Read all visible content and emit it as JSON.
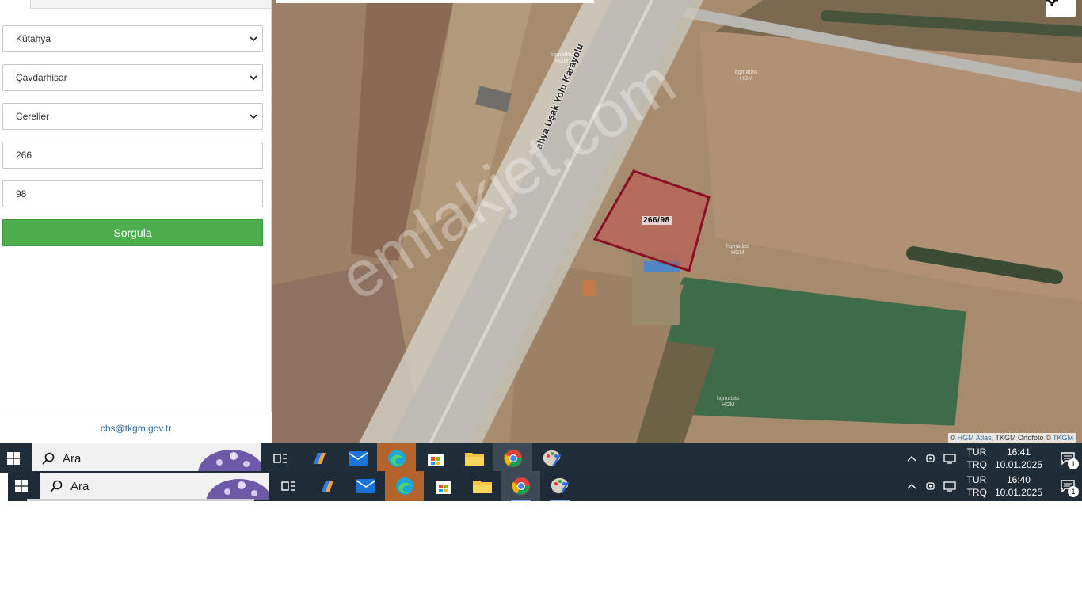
{
  "form": {
    "province": "Kütahya",
    "district": "Çavdarhisar",
    "neighborhood": "Cereller",
    "block_no": "266",
    "parcel_no": "98",
    "submit_label": "Sorgula"
  },
  "footer": {
    "email": "cbs@tkgm.gov.tr"
  },
  "map": {
    "parcel_label": "266/98",
    "road_label": "ahya Uşak Yolu Karayolu",
    "watermark": "emlakjet.com",
    "hgm_marks": [
      "hgmatlas\nHGM",
      "hgmatlas\nHGM",
      "hgmatlas\nHGM",
      "hgmatlas\nHGM"
    ],
    "attribution": {
      "prefix": "© ",
      "hgm": "HGM Atlas",
      "middle": ", TKGM Ortofoto © ",
      "tkgm": "TKGM"
    },
    "parcel_color": "#8b0f24",
    "settings_icon": "gear-icon"
  },
  "taskbar1": {
    "search_label": "Ara",
    "lang_top": "TUR",
    "lang_bottom": "TRQ",
    "time": "16:41",
    "date": "10.01.2025",
    "notification_count": "1"
  },
  "taskbar2": {
    "search_label": "Ara",
    "lang_top": "TUR",
    "lang_bottom": "TRQ",
    "time": "16:40",
    "date": "10.01.2025",
    "notification_count": "1"
  },
  "taskbar_apps": [
    "task-view-icon",
    "copilot-icon",
    "mail-icon",
    "edge-icon",
    "store-icon",
    "file-explorer-icon",
    "chrome-icon",
    "paint-icon"
  ]
}
